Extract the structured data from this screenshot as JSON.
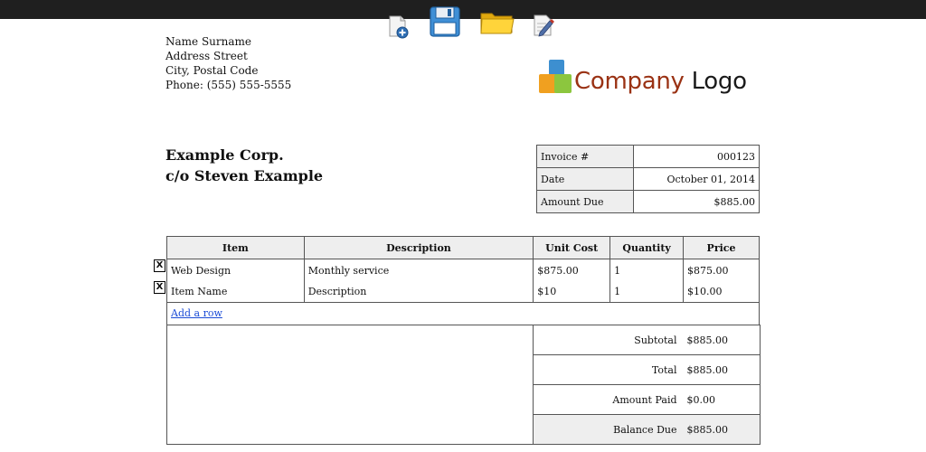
{
  "sender": {
    "name": "Name Surname",
    "street": "Address Street",
    "city": "City, Postal Code",
    "phone": "Phone: (555) 555-5555"
  },
  "logo": {
    "word1": "Company",
    "word2": "Logo",
    "colors": {
      "orange": "#f0a020",
      "blue": "#3d8fd0",
      "green": "#8cc63e",
      "text_red": "#9a3214"
    }
  },
  "toolbar": {
    "icons": [
      "new-document-icon",
      "save-floppy-icon",
      "open-folder-icon",
      "edit-document-icon"
    ]
  },
  "client": {
    "company": "Example Corp.",
    "contact": "c/o Steven Example"
  },
  "meta": {
    "invoice_label": "Invoice #",
    "invoice_value": "000123",
    "date_label": "Date",
    "date_value": "October 01, 2014",
    "due_label": "Amount Due",
    "due_value": "$885.00"
  },
  "items": {
    "headers": [
      "Item",
      "Description",
      "Unit Cost",
      "Quantity",
      "Price"
    ],
    "rows": [
      {
        "item": "Web Design",
        "description": "Monthly service",
        "unit_cost": "$875.00",
        "quantity": "1",
        "price": "$875.00"
      },
      {
        "item": "Item Name",
        "description": "Description",
        "unit_cost": "$10",
        "quantity": "1",
        "price": "$10.00"
      }
    ],
    "delete_label": "X",
    "add_row_label": "Add a row"
  },
  "totals": {
    "subtotal_label": "Subtotal",
    "subtotal_value": "$885.00",
    "total_label": "Total",
    "total_value": "$885.00",
    "paid_label": "Amount Paid",
    "paid_value": "$0.00",
    "balance_label": "Balance Due",
    "balance_value": "$885.00"
  }
}
